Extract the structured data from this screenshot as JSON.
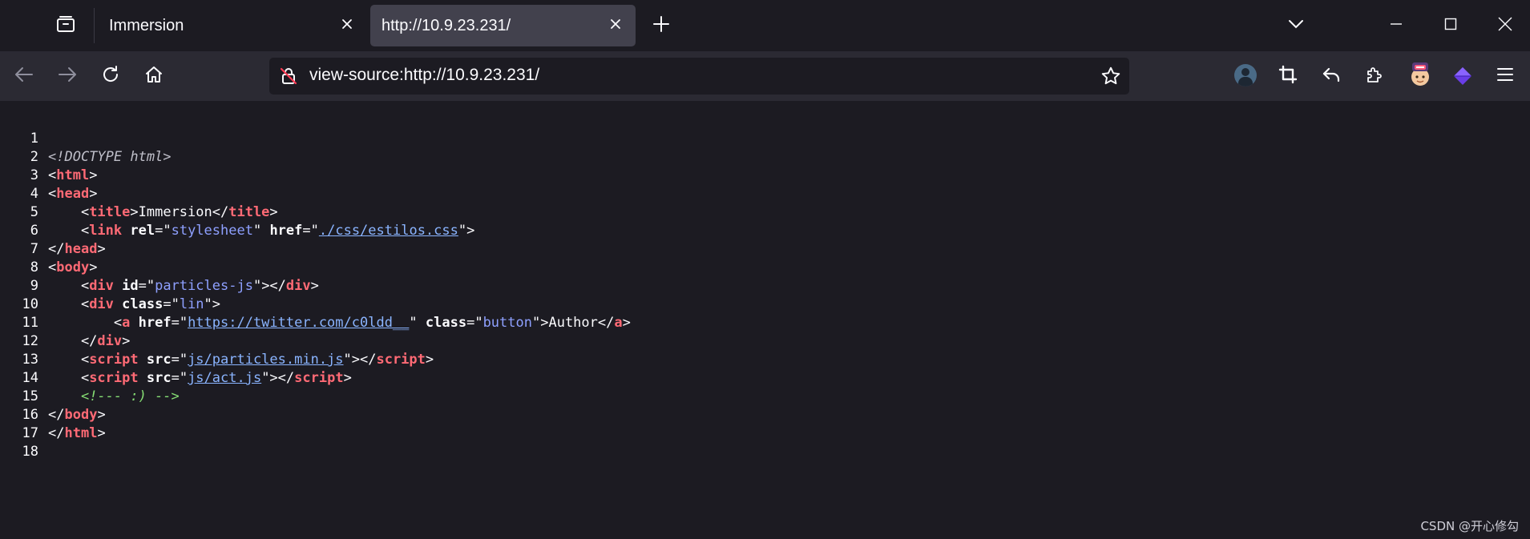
{
  "browser": {
    "tabs": [
      {
        "title": "Immersion",
        "active": false
      },
      {
        "title": "http://10.9.23.231/",
        "active": true
      }
    ],
    "url": "view-source:http://10.9.23.231/"
  },
  "icons": {
    "tab_list": "folder-icon",
    "close": "close-icon",
    "new_tab": "plus-icon",
    "list_all_tabs": "chevron-down-icon",
    "minimize": "minimize-icon",
    "maximize": "maximize-icon",
    "window_close": "close-icon",
    "back": "arrow-left-icon",
    "forward": "arrow-right-icon",
    "reload": "reload-icon",
    "home": "home-icon",
    "insecure": "insecure-lock-icon",
    "bookmark": "star-icon",
    "account": "avatar-icon",
    "screenshot": "crop-icon",
    "undo": "undo-icon",
    "extensions": "puzzle-icon",
    "extension_face": "face-icon",
    "extension_gem": "gem-icon",
    "menu": "hamburger-menu-icon"
  },
  "source": {
    "line_numbers": [
      "1",
      "2",
      "3",
      "4",
      "5",
      "6",
      "7",
      "8",
      "9",
      "10",
      "11",
      "12",
      "13",
      "14",
      "15",
      "16",
      "17",
      "18"
    ],
    "l1": "<!DOCTYPE html>",
    "html": "html",
    "head": "head",
    "title": "title",
    "title_text": "Immersion",
    "link": "link",
    "rel": "rel",
    "stylesheet": "stylesheet",
    "href": "href",
    "css_href": "./css/estilos.css",
    "body": "body",
    "div": "div",
    "id": "id",
    "particles": "particles-js",
    "class": "class",
    "lin": "lin",
    "a": "a",
    "twitter": "https://twitter.com/c0ldd__",
    "button": "button",
    "author": "Author",
    "script": "script",
    "src": "src",
    "js1": "js/particles.min.js",
    "js2": "js/act.js",
    "comment": "<!--- :) -->"
  },
  "watermark": "CSDN @开心修勾",
  "colors": {
    "background": "#1c1b22",
    "toolbar": "#2b2a33",
    "active_tab": "#42414d",
    "tag": "#ff6a75",
    "value": "#8ea0ff",
    "comment": "#86de74"
  }
}
